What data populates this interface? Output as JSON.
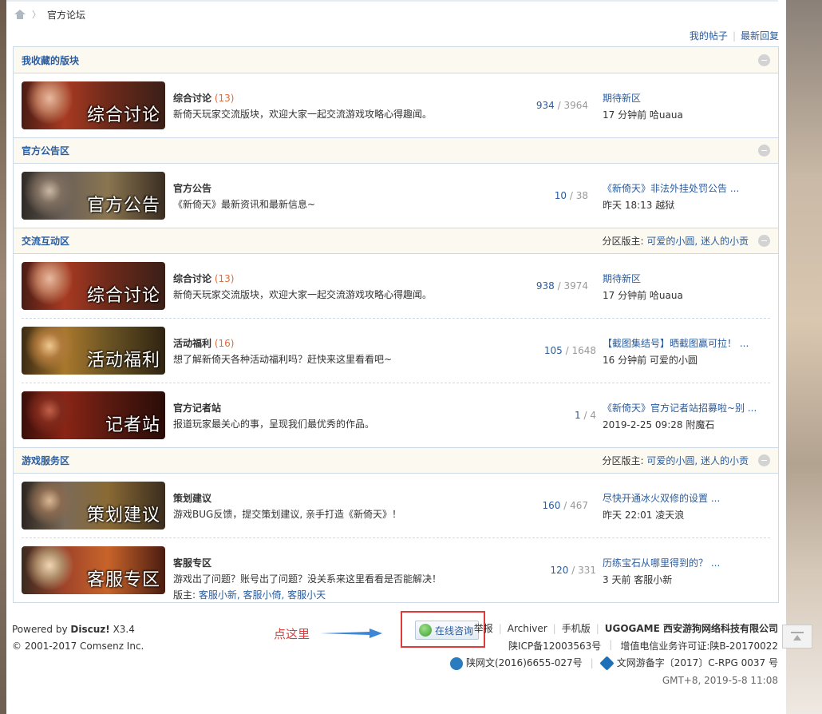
{
  "breadcrumb": {
    "current": "官方论坛"
  },
  "quick_links": {
    "my_threads": "我的帖子",
    "latest_replies": "最新回复"
  },
  "categories": [
    {
      "title": "我收藏的版块",
      "mods_label": "",
      "mods": "",
      "forums": [
        {
          "thumb_text": "综合讨论",
          "name": "综合讨论",
          "new": "(13)",
          "desc": "新倚天玩家交流版块，欢迎大家一起交流游戏攻略心得趣闻。",
          "threads": "934",
          "posts": "3964",
          "last_title": "期待新区",
          "last_time": "17 分钟前 哈uaua"
        }
      ]
    },
    {
      "title": "官方公告区",
      "mods_label": "",
      "mods": "",
      "forums": [
        {
          "thumb_text": "官方公告",
          "name": "官方公告",
          "new": "",
          "desc": "《新倚天》最新资讯和最新信息~",
          "threads": "10",
          "posts": "38",
          "last_title": "《新倚天》非法外挂处罚公告 ...",
          "last_time": "昨天 18:13 越狱"
        }
      ]
    },
    {
      "title": "交流互动区",
      "mods_label": "分区版主:",
      "mods": "可爱的小圆, 迷人的小贡",
      "forums": [
        {
          "thumb_text": "综合讨论",
          "name": "综合讨论",
          "new": "(13)",
          "desc": "新倚天玩家交流版块，欢迎大家一起交流游戏攻略心得趣闻。",
          "threads": "938",
          "posts": "3974",
          "last_title": "期待新区",
          "last_time": "17 分钟前 哈uaua"
        },
        {
          "thumb_text": "活动福利",
          "name": "活动福利",
          "new": "(16)",
          "desc": "想了解新倚天各种活动福利吗？赶快来这里看看吧~",
          "threads": "105",
          "posts": "1648",
          "last_title": "【截图集结号】晒截图赢可拉！ ...",
          "last_time": "16 分钟前 可爱的小圆"
        },
        {
          "thumb_text": "记者站",
          "name": "官方记者站",
          "new": "",
          "desc": "报道玩家最关心的事，呈现我们最优秀的作品。",
          "threads": "1",
          "posts": "4",
          "last_title": "《新倚天》官方记者站招募啦~别 ...",
          "last_time": "2019-2-25 09:28 附魔石"
        }
      ]
    },
    {
      "title": "游戏服务区",
      "mods_label": "分区版主:",
      "mods": "可爱的小圆, 迷人的小贡",
      "forums": [
        {
          "thumb_text": "策划建议",
          "name": "策划建议",
          "new": "",
          "desc": "游戏BUG反馈，提交策划建议, 亲手打造《新倚天》！",
          "threads": "160",
          "posts": "467",
          "last_title": "尽快开通冰火双修的设置 ...",
          "last_time": "昨天 22:01 凌天浪"
        },
        {
          "thumb_text": "客服专区",
          "name": "客服专区",
          "new": "",
          "desc": "游戏出了问题？账号出了问题？没关系来这里看看是否能解决！",
          "mods_label": "版主:",
          "mods": "客服小新, 客服小倚, 客服小天",
          "threads": "120",
          "posts": "331",
          "last_title": "历练宝石从哪里得到的？ ...",
          "last_time": "3 天前 客服小新"
        }
      ]
    }
  ],
  "footer": {
    "powered_prefix": "Powered by",
    "powered_brand": "Discuz!",
    "powered_version": "X3.4",
    "copyright": "© 2001-2017 Comsenz Inc.",
    "annotation": "点这里",
    "consult_label": "在线咨询",
    "links": [
      "举报",
      "Archiver",
      "手机版"
    ],
    "company": "UGOGAME 西安游狗网络科技有限公司",
    "icp": "陕ICP备12003563号",
    "telecom": "增值电信业务许可证:陕B-20170022",
    "culture": "陕网文(2016)6655-027号",
    "game_record": "文网游备字〔2017〕C-RPG 0037 号",
    "gmt": "GMT+8, 2019-5-8 11:08"
  },
  "colors": {
    "link_blue": "#2b5d9e",
    "new_count": "#e06c3c",
    "annotation_red": "#e03a3a",
    "category_bg": "#fcf9f1",
    "border": "#cdd9e5"
  }
}
